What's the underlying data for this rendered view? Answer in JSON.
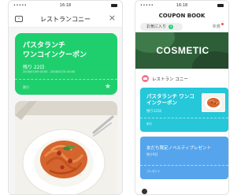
{
  "left_screen": {
    "status": {
      "time": "16:18"
    },
    "header": {
      "title": "レストランコニー",
      "close_glyph": "×"
    },
    "coupon": {
      "name_line1": "パスタランチ",
      "name_line2": "ワンコインクーポン",
      "remaining": "残り 22日",
      "period": "2016/07/09 00:00 - 2016/07/31 00:00",
      "tag": "割引",
      "color": "#1fcf6e"
    }
  },
  "right_screen": {
    "status": {
      "time": "16:18"
    },
    "title": "COUPON BOOK",
    "tabs": {
      "favorites_label": "お気に入り",
      "favorites_count": "3",
      "new_label": "新着"
    },
    "banner": {
      "brand": "COSMETIC",
      "color": "#2d5e38"
    },
    "shop": {
      "name": "レストラン コニー"
    },
    "coupon_a": {
      "name_line1": "パスタランチ ワンコ",
      "name_line2": "インクーポン",
      "remaining": "残り22日",
      "tag": "割引",
      "color": "#25c7d9"
    },
    "coupon_b": {
      "name": "友だち限定ノベルティプレゼント",
      "remaining": "残り9日",
      "tag": "プレゼント",
      "color": "#56a5ec"
    }
  }
}
